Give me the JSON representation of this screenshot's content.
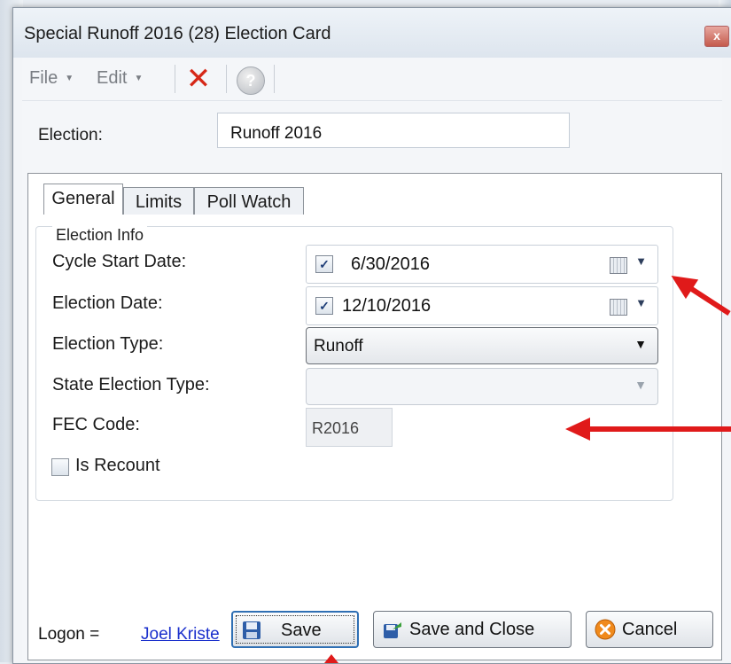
{
  "window": {
    "title": "Special Runoff 2016 (28) Election Card",
    "close_label": "x"
  },
  "menu": {
    "file": "File",
    "edit": "Edit",
    "help_glyph": "?"
  },
  "election": {
    "label": "Election:",
    "value": "Runoff 2016"
  },
  "tabs": [
    {
      "label": "General",
      "active": true
    },
    {
      "label": "Limits",
      "active": false
    },
    {
      "label": "Poll Watch",
      "active": false
    }
  ],
  "group": {
    "title": "Election Info",
    "cycle_start": {
      "label": "Cycle Start Date:",
      "checked": true,
      "value": "6/30/2016"
    },
    "election_date": {
      "label": "Election Date:",
      "checked": true,
      "value": "12/10/2016"
    },
    "election_type": {
      "label": "Election Type:",
      "value": "Runoff"
    },
    "state_election_type": {
      "label": "State Election Type:",
      "value": "",
      "enabled": false
    },
    "fec_code": {
      "label": "FEC Code:",
      "value": "R2016"
    },
    "is_recount": {
      "label": "Is Recount",
      "checked": false
    }
  },
  "footer": {
    "logon_label": "Logon =",
    "user": "Joel Kriste",
    "save": "Save",
    "save_close": "Save and Close",
    "cancel": "Cancel"
  },
  "colors": {
    "annotation_arrow": "#e01a1a",
    "delete_icon": "#d62818",
    "link": "#1a2fcc"
  }
}
